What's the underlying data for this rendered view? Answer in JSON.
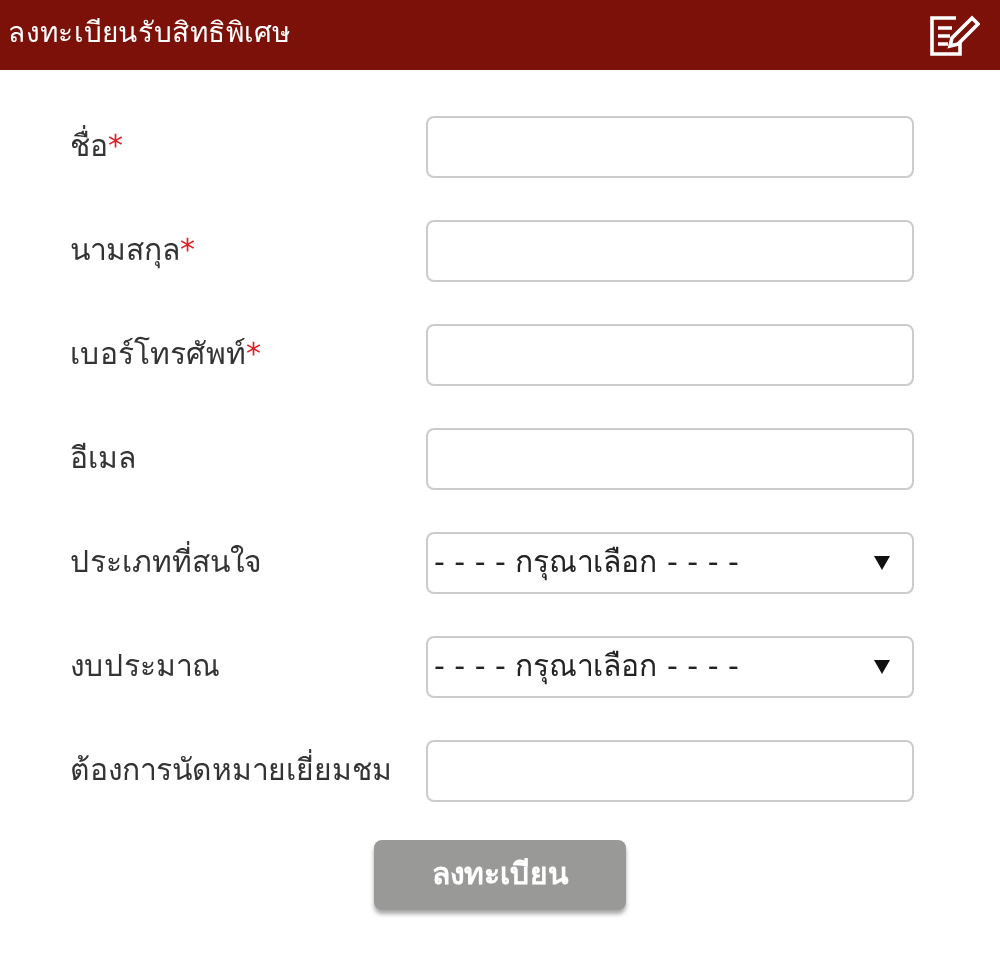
{
  "header": {
    "title": "ลงทะเบียนรับสิทธิพิเศษ"
  },
  "fields": [
    {
      "label": "ชื่อ",
      "required": true,
      "kind": "text"
    },
    {
      "label": "นามสกุล",
      "required": true,
      "kind": "text"
    },
    {
      "label": "เบอร์โทรศัพท์",
      "required": true,
      "kind": "text"
    },
    {
      "label": "อีเมล",
      "required": false,
      "kind": "text"
    },
    {
      "label": "ประเภทที่สนใจ",
      "required": false,
      "kind": "select",
      "value": "- - - - กรุณาเลือก - - - -"
    },
    {
      "label": "งบประมาณ",
      "required": false,
      "kind": "select",
      "value": "- - - - กรุณาเลือก - - - -"
    },
    {
      "label": "ต้องการนัดหมายเยี่ยมชม",
      "required": false,
      "kind": "text"
    }
  ],
  "required_mark": "*",
  "submit_button": "ลงทะเบียน"
}
